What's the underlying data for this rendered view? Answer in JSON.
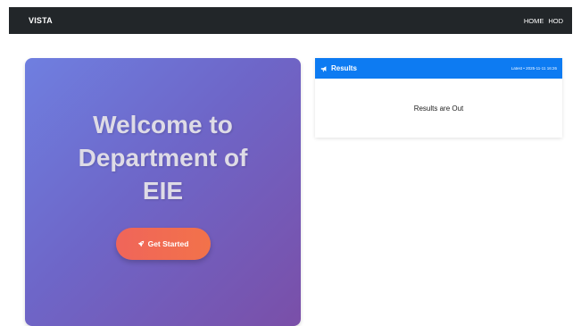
{
  "navbar": {
    "brand": "VISTA",
    "links": [
      "HOME",
      "HOD"
    ]
  },
  "hero": {
    "title_lines": [
      "Welcome to",
      "Department of",
      "EIE"
    ],
    "cta_label": "Get Started",
    "cta_icon": "rocket-icon"
  },
  "results": {
    "title": "Results",
    "title_icon": "megaphone-icon",
    "updated": "Latest • 2025-11-11 16:26",
    "body_text": "Results are Out"
  },
  "colors": {
    "navbar_bg": "#222629",
    "hero_gradient_start": "#6f7fe0",
    "hero_gradient_end": "#7a4fa8",
    "cta_bg": "#f0655a",
    "results_header_bg": "#0d7bf2"
  }
}
